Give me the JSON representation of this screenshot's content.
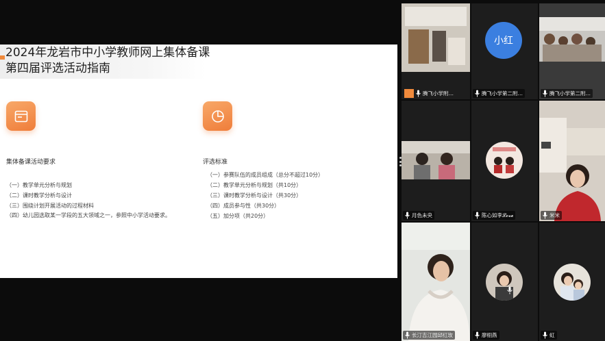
{
  "slide": {
    "title_line1": "2024年龙岩市中小学教师网上集体备课",
    "title_line2": "第四届评选活动指南",
    "accent_color": "#ef7d3a",
    "left_card": {
      "icon": "window-icon",
      "heading": "集体备课活动要求",
      "items": [
        "（一）教学单元分析与规划",
        "（二）课时教学分析与设计",
        "（三）围绕计划开展活动的过程材料",
        "（四）幼儿园选取某一学段的五大领域之一，参照中小学活动要求。"
      ]
    },
    "right_card": {
      "icon": "pie-chart-icon",
      "heading": "评选标准",
      "items": [
        "（一）参赛队伍的成员组成（总分不超过10分）",
        "（二）教学单元分析与规划（共10分）",
        "（三）课时教学分析与设计（共30分）",
        "（四）成员参与性（共30分）",
        "（五）加分项（共20分）"
      ]
    }
  },
  "participants": [
    {
      "name": "腾飞小学附…",
      "icon": "camera-room-icon",
      "mic": "on"
    },
    {
      "name": "腾飞小学第二附…",
      "avatar_text": "小红",
      "mic": "on"
    },
    {
      "name": "腾飞小学第二附…",
      "icon": "camera-group-icon",
      "mic": "on"
    },
    {
      "name": "月色未央",
      "icon": "camera-two-people-icon",
      "mic": "on"
    },
    {
      "name": "陈心如李𝓛𝓸𝓿𝓮",
      "icon": "avatar-couple-icon",
      "mic": "on"
    },
    {
      "name": "米米",
      "icon": "camera-woman-icon",
      "mic": "on"
    },
    {
      "name": "长汀吉江园邱红玫",
      "icon": "camera-woman-icon",
      "mic": "on"
    },
    {
      "name": "廖栩燕",
      "icon": "avatar-girl-icon",
      "mic": "muted"
    },
    {
      "name": "虹",
      "icon": "avatar-mother-child-icon",
      "mic": "on"
    }
  ]
}
